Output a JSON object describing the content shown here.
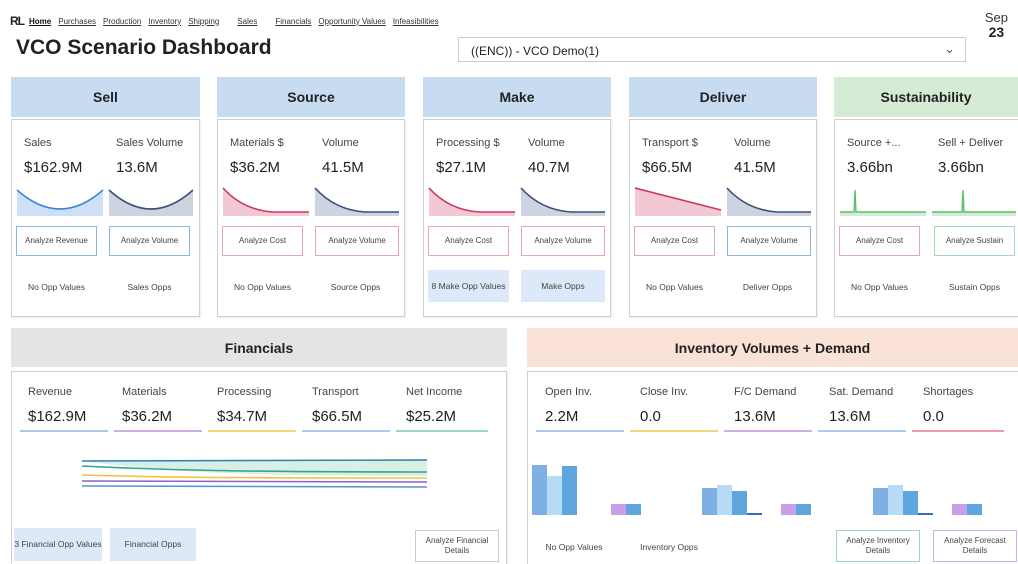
{
  "nav": {
    "logo": "RL",
    "items": [
      "Home",
      "Purchases",
      "Production",
      "Inventory",
      "Shipping",
      "Sales",
      "Financials",
      "Opportunity Values",
      "Infeasibilities"
    ]
  },
  "title": "VCO Scenario Dashboard",
  "scenario_select": {
    "value": "((ENC)) - VCO Demo(1)"
  },
  "date": {
    "month": "Sep",
    "day": "23"
  },
  "colors": {
    "sell_header": "#c7dcf1",
    "sust_header": "#d5ebd6",
    "fin_header": "#e4e4e4",
    "inv_header": "#fbe2d6",
    "red": "#c9395c",
    "navy": "#3b4f7a",
    "blue": "#3a86d4",
    "green": "#5cbf6b"
  },
  "sections": [
    {
      "title": "Sell",
      "m1_label": "Sales",
      "m1_value": "$162.9M",
      "m2_label": "Sales Volume",
      "m2_value": "13.6M",
      "btn1": "Analyze Revenue",
      "btn2": "Analyze Volume",
      "opp1": "No Opp Values",
      "opp2": "Sales Opps"
    },
    {
      "title": "Source",
      "m1_label": "Materials $",
      "m1_value": "$36.2M",
      "m2_label": "Volume",
      "m2_value": "41.5M",
      "btn1": "Analyze Cost",
      "btn2": "Analyze Volume",
      "opp1": "No Opp Values",
      "opp2": "Source Opps"
    },
    {
      "title": "Make",
      "m1_label": "Processing $",
      "m1_value": "$27.1M",
      "m2_label": "Volume",
      "m2_value": "40.7M",
      "btn1": "Analyze Cost",
      "btn2": "Analyze Volume",
      "opp1": "8 Make Opp Values",
      "opp2": "Make Opps"
    },
    {
      "title": "Deliver",
      "m1_label": "Transport $",
      "m1_value": "$66.5M",
      "m2_label": "Volume",
      "m2_value": "41.5M",
      "btn1": "Analyze Cost",
      "btn2": "Analyze Volume",
      "opp1": "No Opp Values",
      "opp2": "Deliver Opps"
    },
    {
      "title": "Sustainability",
      "m1_label": "Source +...",
      "m1_value": "3.66bn",
      "m2_label": "Sell + Deliver",
      "m2_value": "3.66bn",
      "btn1": "Analyze Cost",
      "btn2": "Analyze Sustain",
      "opp1": "No Opp Values",
      "opp2": "Sustain Opps"
    }
  ],
  "financials": {
    "title": "Financials",
    "metrics": [
      {
        "label": "Revenue",
        "value": "$162.9M"
      },
      {
        "label": "Materials",
        "value": "$36.2M"
      },
      {
        "label": "Processing",
        "value": "$34.7M"
      },
      {
        "label": "Transport",
        "value": "$66.5M"
      },
      {
        "label": "Net Income",
        "value": "$25.2M"
      }
    ],
    "opp1": "3 Financial Opp Values",
    "opp2": "Financial Opps",
    "btn": "Analyze Financial Details"
  },
  "inventory": {
    "title": "Inventory Volumes + Demand",
    "metrics": [
      {
        "label": "Open Inv.",
        "value": "2.2M"
      },
      {
        "label": "Close Inv.",
        "value": "0.0"
      },
      {
        "label": "F/C Demand",
        "value": "13.6M"
      },
      {
        "label": "Sat. Demand",
        "value": "13.6M"
      },
      {
        "label": "Shortages",
        "value": "0.0"
      }
    ],
    "opp1": "No Opp Values",
    "opp2": "Inventory Opps",
    "btn1": "Analyze Inventory Details",
    "btn2": "Analyze Forecast Details"
  }
}
